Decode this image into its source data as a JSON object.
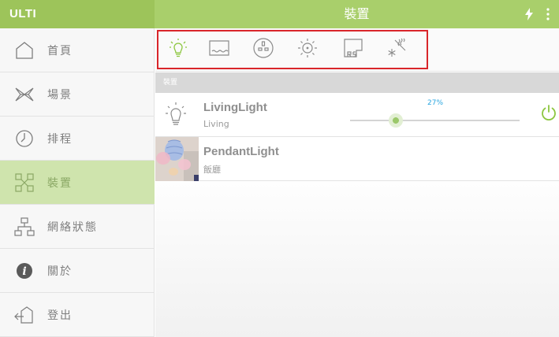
{
  "app": {
    "brand": "ULTI",
    "title": "裝置"
  },
  "header": {
    "icons": [
      "lightning-icon",
      "more-vertical-icon"
    ]
  },
  "sidebar": {
    "items": [
      {
        "label": "首頁",
        "icon": "home-icon",
        "active": false
      },
      {
        "label": "場景",
        "icon": "scene-icon",
        "active": false
      },
      {
        "label": "排程",
        "icon": "clock-icon",
        "active": false
      },
      {
        "label": "裝置",
        "icon": "device-icon",
        "active": true
      },
      {
        "label": "網絡狀態",
        "icon": "network-icon",
        "active": false
      },
      {
        "label": "關於",
        "icon": "info-icon",
        "active": false
      },
      {
        "label": "登出",
        "icon": "logout-icon",
        "active": false
      }
    ]
  },
  "device_types": [
    {
      "icon": "bulb-icon",
      "active": true
    },
    {
      "icon": "curtain-icon",
      "active": false
    },
    {
      "icon": "socket-icon",
      "active": false
    },
    {
      "icon": "sun-icon",
      "active": false
    },
    {
      "icon": "rs-panel-icon",
      "active": false
    },
    {
      "icon": "aircon-icon",
      "active": false
    }
  ],
  "section": {
    "label": "裝置"
  },
  "devices": [
    {
      "name": "LivingLight",
      "room": "Living",
      "icon": "bulb-icon",
      "brightness_label": "27%",
      "brightness": 0.27,
      "has_power": true
    },
    {
      "name": "PendantLight",
      "room": "飯廳",
      "icon": "photo-thumbnail",
      "has_power": false
    }
  ],
  "colors": {
    "accent": "#a9cf6b",
    "active_bg": "#cfe4ad",
    "highlight_frame": "#d9252a",
    "percent_text": "#2aa6e0"
  }
}
